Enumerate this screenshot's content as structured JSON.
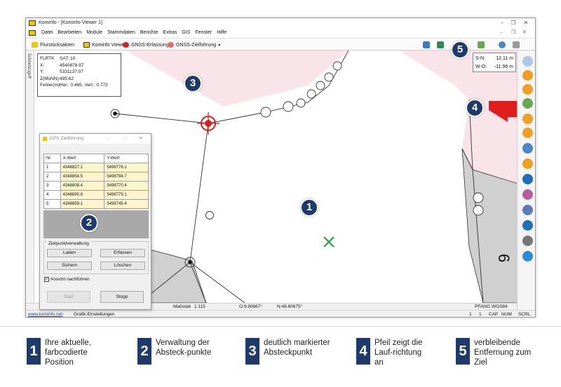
{
  "app": {
    "title": "Kominfo - [Kominfo-Viewer 1]",
    "menu": [
      "Datei",
      "Bearbeiten",
      "Module",
      "Stammdaten",
      "Berichte",
      "Extras",
      "GIS",
      "Fenster",
      "Hilfe"
    ],
    "toolbar": [
      "Flurstücksakten",
      "Kominfo Viewer",
      "GNSS-Erfassung",
      "GNSS-Zielführung"
    ],
    "side_tab": "Schnellzugriff"
  },
  "gps_info": {
    "rows": [
      {
        "k": "FLRTK",
        "v": "SAT: 10"
      },
      {
        "k": "X:",
        "v": "4540878.97"
      },
      {
        "k": "Y:",
        "v": "5331137.07"
      },
      {
        "k": "Z(MüNN):",
        "v": "495.62"
      },
      {
        "k": "Fehler(m):",
        "v": "Hor.: 0.465, Vert.: 0.773"
      }
    ]
  },
  "distance": {
    "sn_label": "S-N:",
    "sn_value": "12.11 m",
    "wo_label": "W-O:",
    "wo_value": "-11.96 m"
  },
  "dialog": {
    "title": "GPS Zielführung",
    "columns": [
      "Nr",
      "X-Wert",
      "Y-Wert"
    ],
    "rows": [
      [
        "1",
        "4348827.1",
        "5498776.1"
      ],
      [
        "2",
        "4348854.5",
        "5498794.7"
      ],
      [
        "3",
        "4348808.4",
        "5498770.4"
      ],
      [
        "4",
        "4348890.8",
        "5498779.1"
      ],
      [
        "5",
        "4348859.1",
        "5498745.4"
      ]
    ],
    "group_label": "Zielpunktverwaltung",
    "btn_laden": "Laden",
    "btn_erfassen": "Erfassen",
    "btn_sichern": "Sichern",
    "btn_loeschen": "Löschen",
    "checkbox": "Ansicht nachführen",
    "btn_start": "Start",
    "btn_stopp": "Stopp"
  },
  "map": {
    "parcel_number": "6"
  },
  "status": {
    "scale_label": "Maßstab",
    "scale_value": "1:115",
    "o_coord": "O:9.90667°",
    "n_coord": "N:49.60675°",
    "pfang": "PFANG",
    "crs": "WGS84",
    "link": "www.kominfo.net",
    "grafik": "Grafik-Einstellungen",
    "page_a": "1",
    "page_b": "1",
    "cap": "CAP",
    "num": "NUM",
    "scrl": "SCRL"
  },
  "badges": [
    "1",
    "2",
    "3",
    "4",
    "5"
  ],
  "legend": [
    {
      "num": "1",
      "text": "Ihre aktuelle, farbcodierte Position"
    },
    {
      "num": "2",
      "text": "Verwaltung der Absteck-punkte"
    },
    {
      "num": "3",
      "text": "deutlich markierter Absteckpunkt"
    },
    {
      "num": "4",
      "text": "Pfeil zeigt die Lauf-richtung an"
    },
    {
      "num": "5",
      "text": "verbleibende Entfernung zum Ziel"
    }
  ],
  "colors": {
    "parcel_fill": "#f9e4ea",
    "gray_fill": "#d0d0d0",
    "badge": "#1d3a6b",
    "target": "#d42020",
    "position": "#1f9e3a",
    "arrow": "#e01c1c",
    "highlight": "#fff5cc"
  }
}
